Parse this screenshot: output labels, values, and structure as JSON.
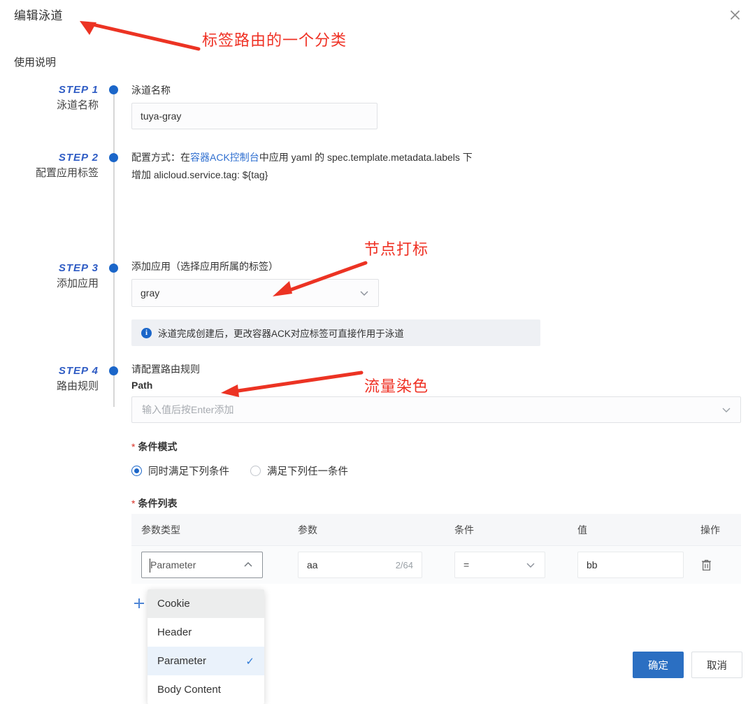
{
  "dialog": {
    "title": "编辑泳道",
    "usage_note": "使用说明",
    "close_icon": "close-icon"
  },
  "steps": [
    {
      "number": "STEP 1",
      "name": "泳道名称",
      "field_label": "泳道名称",
      "value": "tuya-gray"
    },
    {
      "number": "STEP 2",
      "name": "配置应用标签",
      "desc_prefix": "配置方式：在",
      "desc_link": "容器ACK控制台",
      "desc_mid": "中应用 yaml 的 spec.template.metadata.labels 下",
      "desc_line2": "增加 alicloud.service.tag: ${tag}"
    },
    {
      "number": "STEP 3",
      "name": "添加应用",
      "field_label": "添加应用（选择应用所属的标签）",
      "select_value": "gray",
      "info_text": "泳道完成创建后，更改容器ACK对应标签可直接作用于泳道",
      "info_icon": "info-circle-icon"
    },
    {
      "number": "STEP 4",
      "name": "路由规则",
      "field_label": "请配置路由规则",
      "path_label": "Path",
      "path_placeholder": "输入值后按Enter添加"
    }
  ],
  "condition_mode": {
    "label": "条件模式",
    "required_star": "*",
    "options": [
      {
        "label": "同时满足下列条件",
        "selected": true
      },
      {
        "label": "满足下列任一条件",
        "selected": false
      }
    ]
  },
  "condition_list": {
    "label": "条件列表",
    "required_star": "*",
    "columns": [
      "参数类型",
      "参数",
      "条件",
      "值",
      "操作"
    ],
    "rows": [
      {
        "param_type": "Parameter",
        "param": "aa",
        "param_counter": "2/64",
        "operator": "=",
        "value": "bb",
        "delete_icon": "trash-icon"
      }
    ],
    "add_icon": "plus-icon"
  },
  "type_dropdown": {
    "items": [
      {
        "label": "Cookie",
        "state": "hover"
      },
      {
        "label": "Header",
        "state": "normal"
      },
      {
        "label": "Parameter",
        "state": "selected"
      },
      {
        "label": "Body Content",
        "state": "normal"
      }
    ],
    "check_glyph": "✓"
  },
  "footer": {
    "confirm_label": "确定",
    "cancel_label": "取消"
  },
  "annotations": [
    {
      "text": "标签路由的一个分类"
    },
    {
      "text": "节点打标"
    },
    {
      "text": "流量染色"
    }
  ],
  "colors": {
    "accent": "#1b66c9",
    "step_num": "#2f5cc4",
    "link": "#2f6fd0",
    "required": "#d93026",
    "annotation": "#ef3124",
    "confirm_button": "#2b6fc2",
    "info_bg": "#eef0f4",
    "table_header_bg": "#f6f7f9"
  }
}
